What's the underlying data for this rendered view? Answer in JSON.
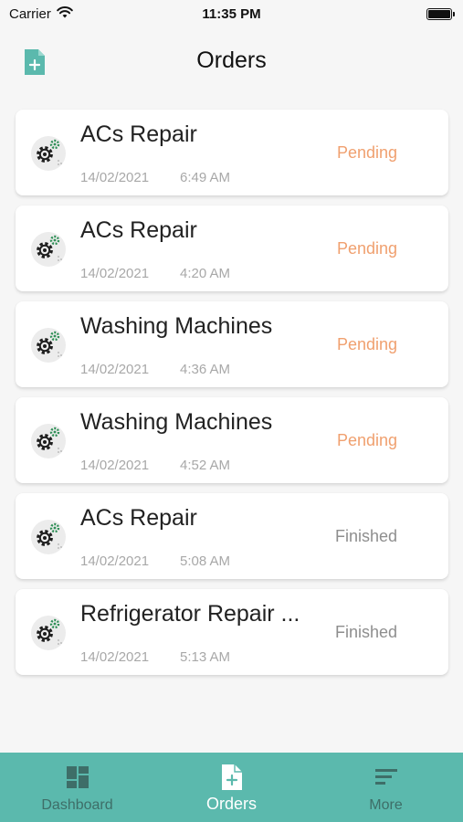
{
  "status_bar": {
    "carrier": "Carrier",
    "time": "11:35 PM"
  },
  "header": {
    "title": "Orders"
  },
  "colors": {
    "accent": "#5bb9ad",
    "pending": "#f0a06f",
    "finished": "#8e8e8e"
  },
  "orders": [
    {
      "name": "ACs Repair",
      "date": "14/02/2021",
      "time": "6:49 AM",
      "status": "Pending"
    },
    {
      "name": "ACs Repair",
      "date": "14/02/2021",
      "time": "4:20 AM",
      "status": "Pending"
    },
    {
      "name": "Washing Machines",
      "date": "14/02/2021",
      "time": "4:36 AM",
      "status": "Pending"
    },
    {
      "name": "Washing Machines",
      "date": "14/02/2021",
      "time": "4:52 AM",
      "status": "Pending"
    },
    {
      "name": "ACs Repair",
      "date": "14/02/2021",
      "time": "5:08 AM",
      "status": "Finished"
    },
    {
      "name": "Refrigerator Repair ...",
      "date": "14/02/2021",
      "time": "5:13 AM",
      "status": "Finished"
    }
  ],
  "tabs": [
    {
      "label": "Dashboard",
      "icon": "dashboard-icon",
      "active": false
    },
    {
      "label": "Orders",
      "icon": "document-add-icon",
      "active": true
    },
    {
      "label": "More",
      "icon": "menu-lines-icon",
      "active": false
    }
  ]
}
